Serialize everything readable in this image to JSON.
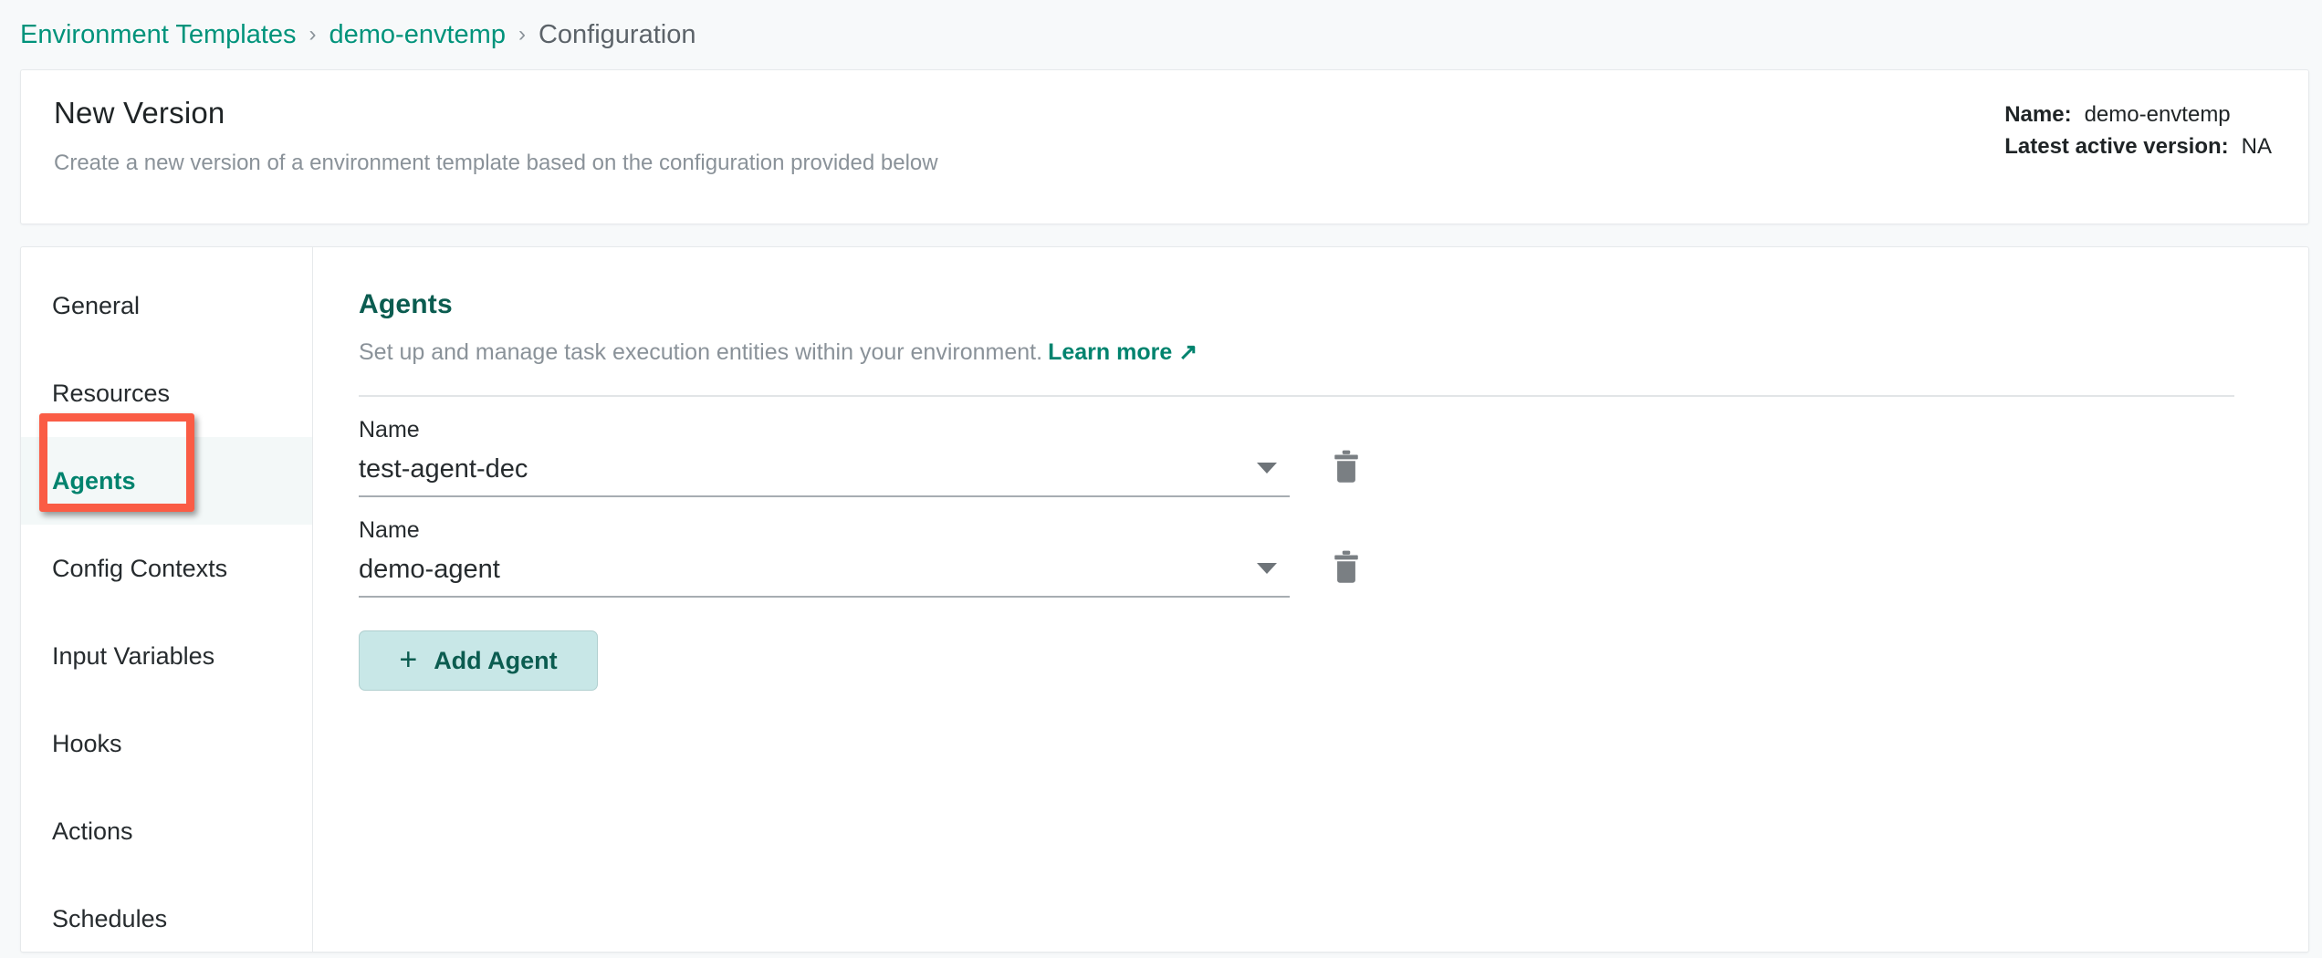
{
  "breadcrumb": {
    "items": [
      {
        "label": "Environment Templates",
        "type": "link"
      },
      {
        "label": "demo-envtemp",
        "type": "link"
      },
      {
        "label": "Configuration",
        "type": "current"
      }
    ],
    "separator": "›"
  },
  "header": {
    "title": "New Version",
    "subtitle": "Create a new version of a environment template based on the configuration provided below",
    "meta": {
      "name_label": "Name:",
      "name_value": "demo-envtemp",
      "version_label": "Latest active version:",
      "version_value": "NA"
    }
  },
  "sidebar": {
    "items": [
      {
        "label": "General",
        "active": false
      },
      {
        "label": "Resources",
        "active": false
      },
      {
        "label": "Agents",
        "active": true
      },
      {
        "label": "Config Contexts",
        "active": false
      },
      {
        "label": "Input Variables",
        "active": false
      },
      {
        "label": "Hooks",
        "active": false
      },
      {
        "label": "Actions",
        "active": false
      },
      {
        "label": "Schedules",
        "active": false
      }
    ]
  },
  "content": {
    "title": "Agents",
    "description": "Set up and manage task execution entities within your environment.",
    "learn_more": "Learn more",
    "learn_more_icon": "external-link-arrow",
    "field_label": "Name",
    "agents": [
      {
        "name": "test-agent-dec"
      },
      {
        "name": "demo-agent"
      }
    ],
    "add_button": {
      "label": "Add Agent",
      "icon": "plus-icon"
    },
    "delete_icon": "trash-icon",
    "dropdown_icon": "chevron-down-icon"
  },
  "annotation": {
    "target": "Agents",
    "color": "#FA5C45"
  },
  "colors": {
    "page_background": "#F7F9FA",
    "card_background": "#FFFFFF",
    "link_teal": "#00937B",
    "heading_teal": "#0B5C50",
    "active_row": "#F3F8F8",
    "button_fill": "#C8E7E7",
    "annotation_red": "#FA5C45"
  }
}
